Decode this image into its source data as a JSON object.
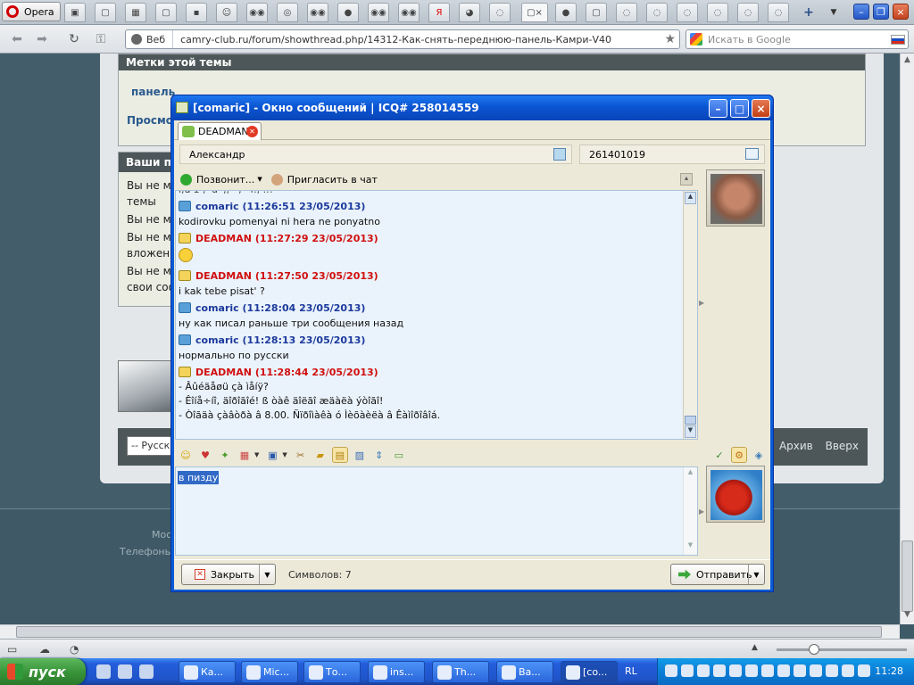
{
  "browser": {
    "menu_label": "Opera",
    "tab_icons": [
      "tab-icon",
      "page-icon",
      "page-icon",
      "page-icon",
      "page-icon",
      "chat-icon",
      "eyes-icon",
      "eye-icon",
      "eyes-icon",
      "drop-icon",
      "eyes-icon",
      "eyes-icon",
      "yandex-icon",
      "page-icon",
      "loading-icon",
      "page-icon",
      "page-icon",
      "loading-icon",
      "loading-icon",
      "loading-icon",
      "loading-icon",
      "loading-icon"
    ],
    "address_prefix": "Веб",
    "url": "camry-club.ru/forum/showthread.php/14312-Как-снять-переднюю-панель-Камри-V40",
    "search_placeholder": "Искать в Google"
  },
  "page": {
    "tags_header": "Метки этой темы",
    "tags_link": "панель",
    "views_link": "Просмот",
    "perms_header": "Ваши пр",
    "perms_lines": [
      "Вы не мо",
      "темы",
      "Вы не мо",
      "Вы не мо",
      "вложени",
      "Вы не мо",
      "свои соо"
    ],
    "style_select": "-- Русски",
    "footer_links": [
      "ь",
      "Архив",
      "Вверх"
    ],
    "bottom_line1": "Мос",
    "bottom_line2": "Телефоны"
  },
  "icq": {
    "title": "[comaric] - Окно сообщений  |  ICQ# 258014559",
    "tab_label": "DEADMAN",
    "contact_name": "Александр",
    "contact_uin": "261401019",
    "call_label": "Позвонит...",
    "invite_label": "Пригласить в чат",
    "history_cut_line": "i,u'1 , 'u'',, ' , ' r., ..!",
    "messages": [
      {
        "sender": "comaric",
        "time": "(11:26:51 23/05/2013)",
        "lines": [
          "kodirovku pomenyai ni hera ne ponyatno"
        ]
      },
      {
        "sender": "DEADMAN",
        "time": "(11:27:29 23/05/2013)",
        "lines": [
          ""
        ]
      },
      {
        "sender": "DEADMAN",
        "time": "(11:27:50 23/05/2013)",
        "lines": [
          "i kak tebe pisat' ?"
        ]
      },
      {
        "sender": "comaric",
        "time": "(11:28:04 23/05/2013)",
        "lines": [
          "ну как писал раньше три сообщения назад"
        ]
      },
      {
        "sender": "comaric",
        "time": "(11:28:13 23/05/2013)",
        "lines": [
          "нормально по русски"
        ]
      },
      {
        "sender": "DEADMAN",
        "time": "(11:28:44 23/05/2013)",
        "lines": [
          "- Âûéäåøü çà ìåíÿ?",
          "- Êîíå÷íî, äîðîãîé! ß òàê äîëãî æäàëà ýòîãî!",
          "- Òîãäà çàâòðà â 8.00. Ñïðîìàêà ó Ìèõàèëà â Êàìîðîâîá."
        ]
      }
    ],
    "input_text": "в пизду",
    "close_label": "Закрыть",
    "chars_label": "Символов:  7",
    "send_label": "Отправить"
  },
  "taskbar": {
    "start_label": "пуск",
    "buttons": [
      "Ка...",
      "Mic...",
      "То...",
      "ins...",
      "Th...",
      "Ва...",
      "[co..."
    ],
    "lang": "RL",
    "clock": "11:28"
  }
}
